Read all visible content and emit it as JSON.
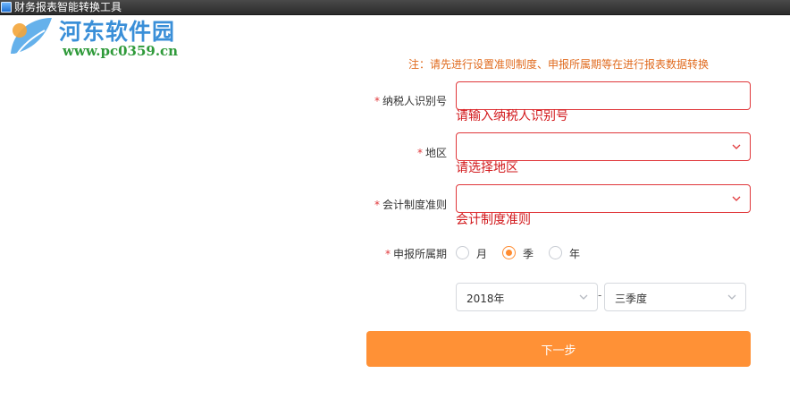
{
  "window": {
    "title": "财务报表智能转换工具",
    "icon": "app-icon"
  },
  "watermark": {
    "site_name": "河东软件园",
    "url": "www.pc0359.cn"
  },
  "form": {
    "notice": "注：请先进行设置准则制度、申报所属期等在进行报表数据转换",
    "required_mark": "*",
    "taxpayer_id": {
      "label": "纳税人识别号",
      "value": "",
      "error": "请输入纳税人识别号"
    },
    "region": {
      "label": "地区",
      "value": "",
      "error": "请选择地区"
    },
    "accounting_system": {
      "label": "会计制度准则",
      "value": "",
      "error": "会计制度准则"
    },
    "period_type": {
      "label": "申报所属期",
      "options": [
        "月",
        "季",
        "年"
      ],
      "selected": "季"
    },
    "year_select": {
      "value": "2018年"
    },
    "separator": "-",
    "quarter_select": {
      "value": "三季度"
    },
    "next_button": "下一步"
  },
  "colors": {
    "accent": "#ff9136",
    "error": "#d2191c",
    "notice": "#e06b1f",
    "title_bar": "#2b2b2b"
  }
}
